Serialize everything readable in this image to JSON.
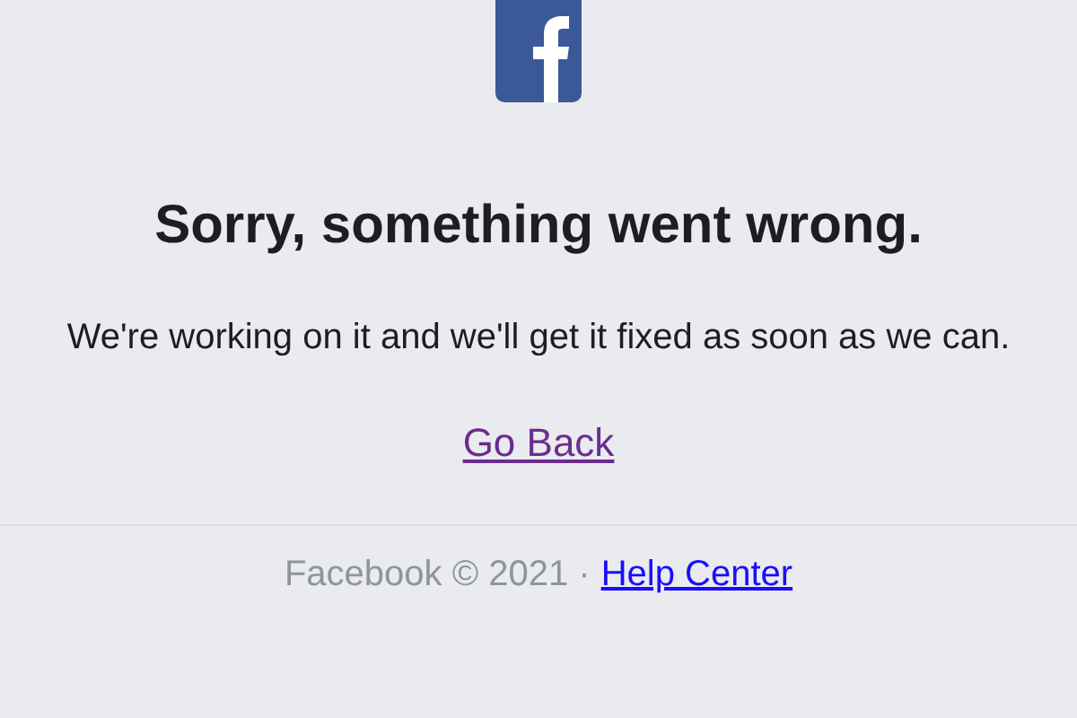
{
  "heading": "Sorry, something went wrong.",
  "message": "We're working on it and we'll get it fixed as soon as we can.",
  "back_link": {
    "label": "Go Back",
    "visited": true
  },
  "footer": {
    "text": "Facebook © 2021 ·",
    "link": {
      "label": "Help Center",
      "visited": false
    }
  }
}
